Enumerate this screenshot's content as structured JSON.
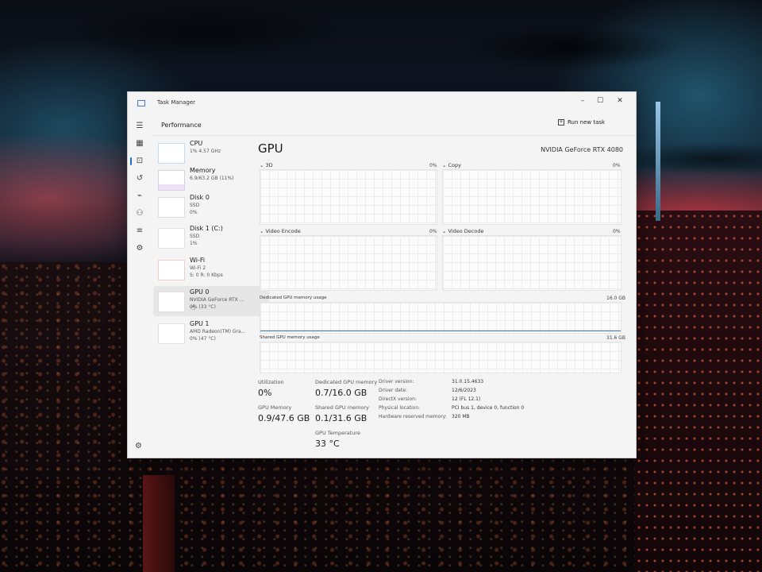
{
  "window": {
    "title": "Task Manager",
    "controls": {
      "minimize": "–",
      "maximize": "☐",
      "close": "✕"
    }
  },
  "header": {
    "title": "Performance",
    "run_task_label": "Run new task",
    "more_label": "⋯"
  },
  "nav_icons": [
    "hamburger-icon",
    "processes-icon",
    "performance-icon",
    "app-history-icon",
    "startup-apps-icon",
    "users-icon",
    "details-icon",
    "services-icon"
  ],
  "sidebar": {
    "items": [
      {
        "name": "CPU",
        "sub1": "1% 4.57 GHz",
        "sub2": ""
      },
      {
        "name": "Memory",
        "sub1": "6.9/63.2 GB (11%)",
        "sub2": ""
      },
      {
        "name": "Disk 0",
        "sub1": "SSD",
        "sub2": "0%"
      },
      {
        "name": "Disk 1 (C:)",
        "sub1": "SSD",
        "sub2": "1%"
      },
      {
        "name": "Wi-Fi",
        "sub1": "Wi-Fi 2",
        "sub2": "S: 0 R: 0 Kbps"
      },
      {
        "name": "GPU 0",
        "sub1": "NVIDIA GeForce RTX ...",
        "sub2": "0% (33 °C)"
      },
      {
        "name": "GPU 1",
        "sub1": "AMD Radeon(TM) Gra...",
        "sub2": "0% (47 °C)"
      }
    ]
  },
  "main": {
    "title": "GPU",
    "model": "NVIDIA GeForce RTX 4080",
    "graphs": {
      "g3d": {
        "label": "3D",
        "pct": "0%"
      },
      "copy": {
        "label": "Copy",
        "pct": "0%"
      },
      "encode": {
        "label": "Video Encode",
        "pct": "0%"
      },
      "decode": {
        "label": "Video Decode",
        "pct": "0%"
      },
      "dedicated": {
        "label": "Dedicated GPU memory usage",
        "max": "16.0 GB"
      },
      "shared": {
        "label": "Shared GPU memory usage",
        "max": "31.6 GB"
      }
    },
    "stats": {
      "utilization_label": "Utilization",
      "utilization_value": "0%",
      "dedicated_label": "Dedicated GPU memory",
      "dedicated_value": "0.7/16.0 GB",
      "gpu_memory_label": "GPU Memory",
      "gpu_memory_value": "0.9/47.6 GB",
      "shared_label": "Shared GPU memory",
      "shared_value": "0.1/31.6 GB",
      "temp_label": "GPU Temperature",
      "temp_value": "33 °C"
    },
    "info": [
      {
        "label": "Driver version:",
        "value": "31.0.15.4633"
      },
      {
        "label": "Driver date:",
        "value": "12/6/2023"
      },
      {
        "label": "DirectX version:",
        "value": "12 (FL 12.1)"
      },
      {
        "label": "Physical location:",
        "value": "PCI bus 1, device 0, function 0"
      },
      {
        "label": "Hardware reserved memory:",
        "value": "320 MB"
      }
    ]
  }
}
